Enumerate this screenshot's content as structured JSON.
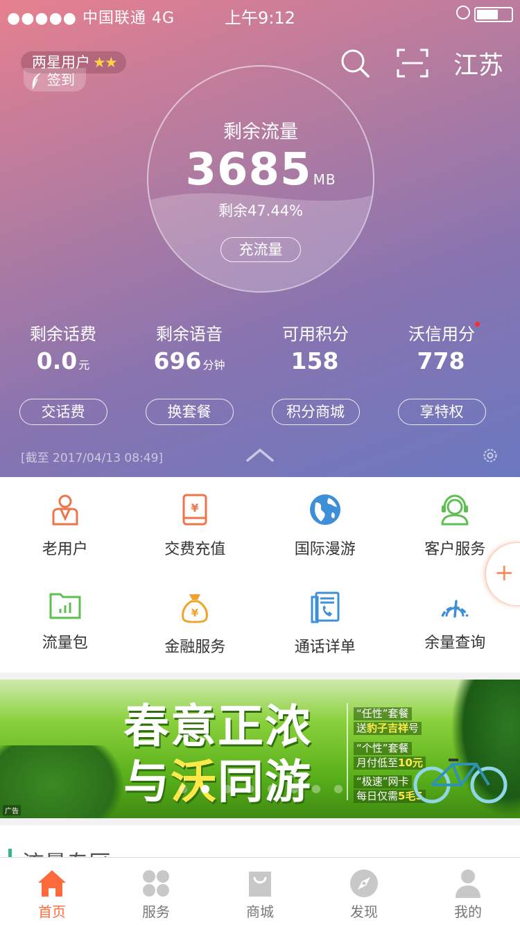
{
  "status_bar": {
    "carrier": "●●●●● 中国联通   4G",
    "time": "上午9:12"
  },
  "header": {
    "member_level": "两星用户",
    "member_stars": "★★",
    "checkin_label": "签到",
    "region": "江苏"
  },
  "data_meter": {
    "label": "剩余流量",
    "value": "3685",
    "unit": "MB",
    "percent_text": "剩余47.44%",
    "recharge_label": "充流量",
    "remaining_fraction": 0.4744
  },
  "stats": [
    {
      "title": "剩余话费",
      "value": "0.0",
      "unit": "元"
    },
    {
      "title": "剩余语音",
      "value": "696",
      "unit": "分钟"
    },
    {
      "title": "可用积分",
      "value": "158",
      "unit": ""
    },
    {
      "title": "沃信用分",
      "value": "778",
      "unit": ""
    }
  ],
  "actions": [
    "交话费",
    "换套餐",
    "积分商城",
    "享特权"
  ],
  "as_of": "[截至 2017/04/13 08:49]",
  "services": [
    {
      "label": "老用户",
      "icon": "user-badge-icon",
      "color": "#f0734a"
    },
    {
      "label": "交费充值",
      "icon": "phone-yuan-icon",
      "color": "#f0734a"
    },
    {
      "label": "国际漫游",
      "icon": "globe-icon",
      "color": "#3d8fd8"
    },
    {
      "label": "客户服务",
      "icon": "headset-icon",
      "color": "#5cbf4f"
    },
    {
      "label": "流量包",
      "icon": "folder-chart-icon",
      "color": "#5cbf4f"
    },
    {
      "label": "金融服务",
      "icon": "money-bag-icon",
      "color": "#f2a22a"
    },
    {
      "label": "通话详单",
      "icon": "call-record-icon",
      "color": "#3d8fd8"
    },
    {
      "label": "余量查询",
      "icon": "gauge-icon",
      "color": "#3d8fd8"
    }
  ],
  "fab_symbol": "+",
  "banner": {
    "title_line1": "春意正浓",
    "title_line2_pre": "与",
    "title_line2_hl": "沃",
    "title_line2_post": "同游",
    "promo1_a": "“任性”套餐",
    "promo1_b_pre": "送",
    "promo1_b_hl": "豹子吉祥",
    "promo1_b_post": "号",
    "promo2_a": "“个性”套餐",
    "promo2_b_pre": "月付低至",
    "promo2_b_hl": "10元",
    "promo3_a": "“极速”网卡",
    "promo3_b_pre": "每日仅需",
    "promo3_b_hl": "5毛5",
    "ad_tag": "广告"
  },
  "section_peek": "流量专区",
  "tabbar": [
    {
      "label": "首页",
      "icon": "home-icon",
      "active": true
    },
    {
      "label": "服务",
      "icon": "grid-icon",
      "active": false
    },
    {
      "label": "商城",
      "icon": "shopping-bag-icon",
      "active": false
    },
    {
      "label": "发现",
      "icon": "compass-icon",
      "active": false
    },
    {
      "label": "我的",
      "icon": "person-icon",
      "active": false
    }
  ],
  "colors": {
    "accent": "#ff6a3d",
    "tab_inactive": "#c8c8c8",
    "gradient_start": "#e6808f",
    "gradient_end": "#6b78c0"
  }
}
